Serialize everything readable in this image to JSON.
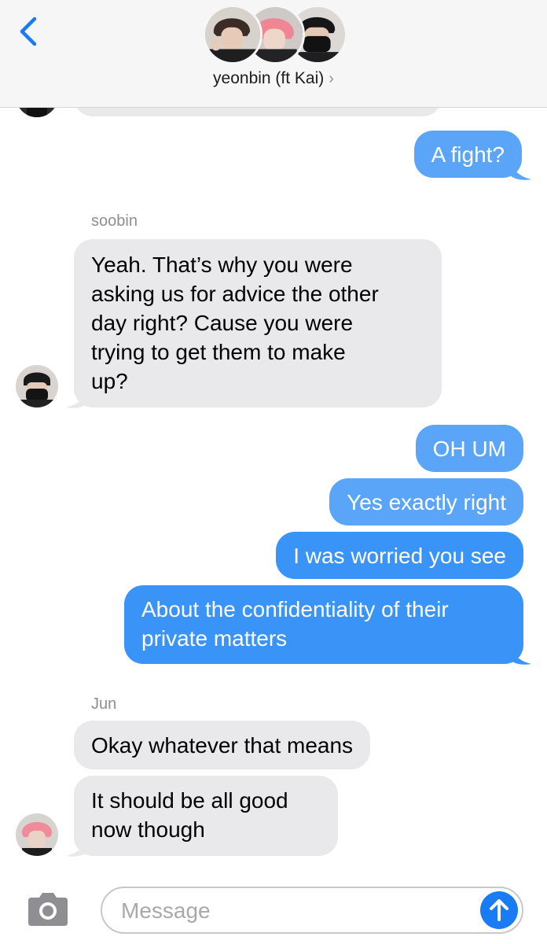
{
  "header": {
    "title": "yeonbin (ft Kai)",
    "chevron": "›"
  },
  "messages": {
    "m1": "A fight?",
    "soobin_label": "soobin",
    "m2_lines": [
      "Yeah. That’s why you were",
      "asking us for advice the other",
      "day right? Cause you were",
      "trying to get them to make",
      "up?"
    ],
    "m3": "OH UM",
    "m4": "Yes exactly right",
    "m5": "I was worried you see",
    "m6_lines": [
      "About the confidentiality of their",
      "private matters"
    ],
    "jun_label": "Jun",
    "m7": "Okay whatever that means",
    "m8_lines": [
      "It should be all good",
      "now though"
    ]
  },
  "input": {
    "placeholder": "Message"
  },
  "colors": {
    "outgoing": "#3a93f7",
    "incoming": "#e9e9eb",
    "accent": "#1a7cf5"
  }
}
